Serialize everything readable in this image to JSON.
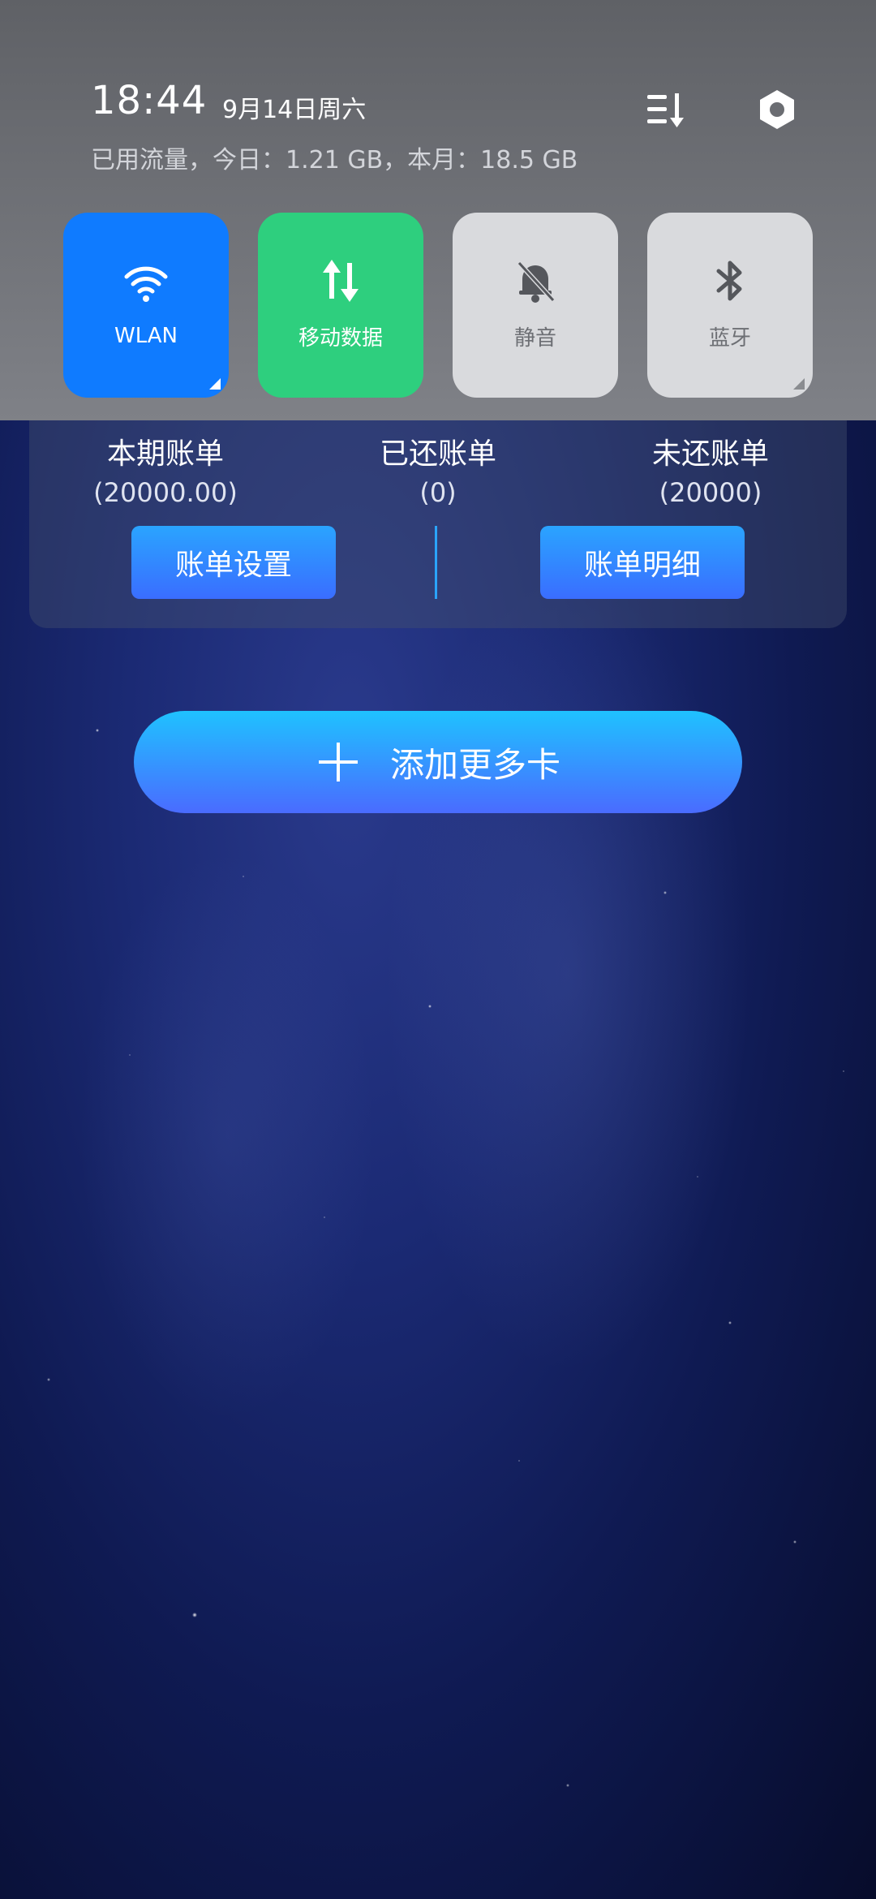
{
  "status": {
    "time": "18:44",
    "date": "9月14日周六",
    "usage": "已用流量，今日：1.21 GB，本月：18.5 GB"
  },
  "quick_settings": [
    {
      "label": "WLAN",
      "icon": "wifi-icon",
      "color": "#0f7bff",
      "active": true
    },
    {
      "label": "移动数据",
      "icon": "mobile-data-icon",
      "color": "#2ecf7e",
      "active": true
    },
    {
      "label": "静音",
      "icon": "bell-mute-icon",
      "color": "#d9dadd",
      "active": false
    },
    {
      "label": "蓝牙",
      "icon": "bluetooth-icon",
      "color": "#d9dadd",
      "active": false
    }
  ],
  "bill": {
    "current": {
      "label": "本期账单",
      "value": "(20000.00)"
    },
    "repaid": {
      "label": "已还账单",
      "value": "(0)"
    },
    "unpaid": {
      "label": "未还账单",
      "value": "(20000)"
    },
    "settings_button": "账单设置",
    "details_button": "账单明细"
  },
  "add_card": {
    "label": "添加更多卡",
    "icon": "plus-icon"
  },
  "colors": {
    "accent": "#2aa4ff",
    "button_gradient_end": "#3a6dff"
  }
}
